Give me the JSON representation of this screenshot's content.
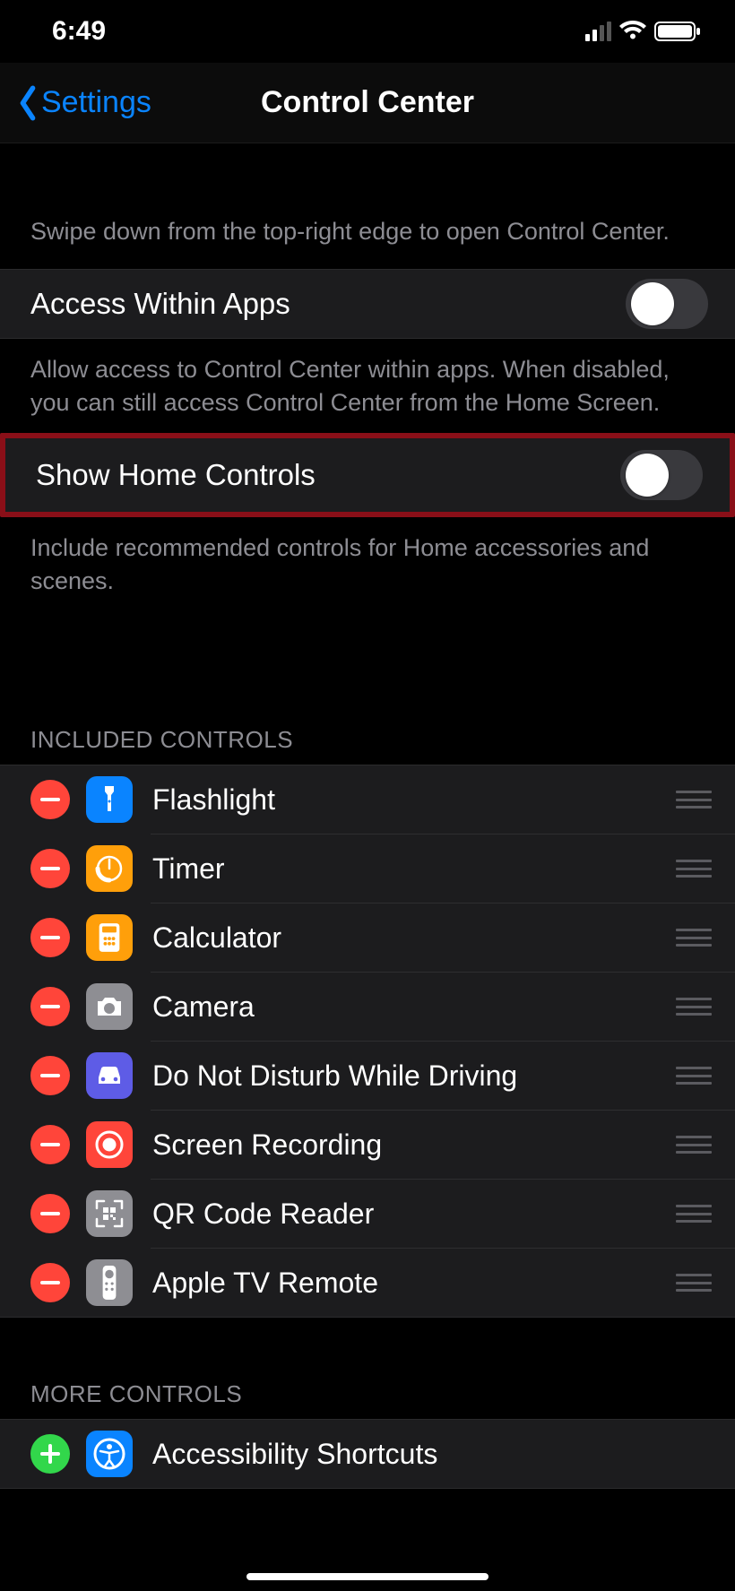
{
  "status": {
    "time": "6:49"
  },
  "nav": {
    "back_label": "Settings",
    "title": "Control Center"
  },
  "descriptions": {
    "swipe": "Swipe down from the top-right edge to open Control Center.",
    "access": "Allow access to Control Center within apps. When disabled, you can still access Control Center from the Home Screen.",
    "home": "Include recommended controls for Home accessories and scenes."
  },
  "toggles": {
    "access_label": "Access Within Apps",
    "access_on": false,
    "home_label": "Show Home Controls",
    "home_on": false
  },
  "sections": {
    "included_header": "INCLUDED CONTROLS",
    "more_header": "MORE CONTROLS"
  },
  "included": [
    {
      "label": "Flashlight",
      "icon": "flashlight",
      "color": "#0a84ff"
    },
    {
      "label": "Timer",
      "icon": "timer",
      "color": "#ff9f0a"
    },
    {
      "label": "Calculator",
      "icon": "calculator",
      "color": "#ff9f0a"
    },
    {
      "label": "Camera",
      "icon": "camera",
      "color": "#8e8e93"
    },
    {
      "label": "Do Not Disturb While Driving",
      "icon": "car",
      "color": "#5e5ce6"
    },
    {
      "label": "Screen Recording",
      "icon": "record",
      "color": "#ff453a"
    },
    {
      "label": "QR Code Reader",
      "icon": "qr",
      "color": "#8e8e93"
    },
    {
      "label": "Apple TV Remote",
      "icon": "remote",
      "color": "#8e8e93"
    }
  ],
  "more": [
    {
      "label": "Accessibility Shortcuts",
      "icon": "accessibility",
      "color": "#0a84ff"
    }
  ]
}
